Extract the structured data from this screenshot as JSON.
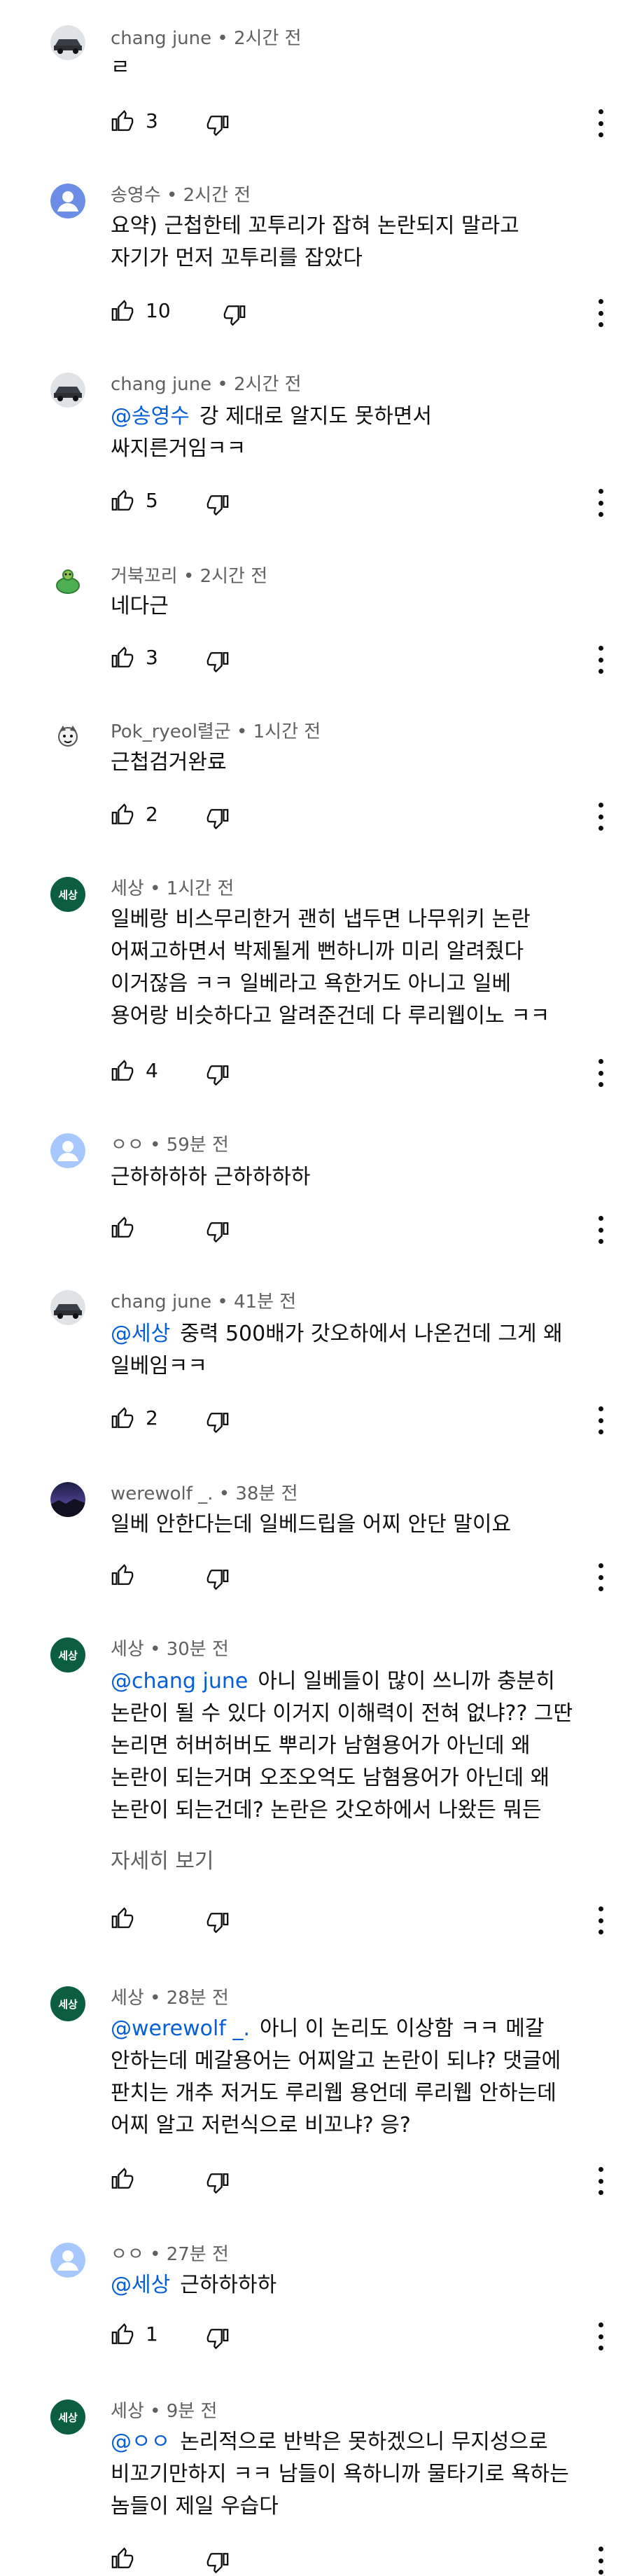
{
  "comments": [
    {
      "author": "chang june",
      "time": "2시간 전",
      "avatar": {
        "type": "car",
        "color": "#3a3f44"
      },
      "mention": "",
      "text": "ㄹ",
      "likes": "3"
    },
    {
      "author": "송영수",
      "time": "2시간 전",
      "avatar": {
        "type": "default",
        "color": "#6b8de6"
      },
      "mention": "",
      "text": "요약) 근첩한테 꼬투리가 잡혀 논란되지 말라고\n자기가 먼저 꼬투리를 잡았다",
      "likes": "10"
    },
    {
      "author": "chang june",
      "time": "2시간 전",
      "avatar": {
        "type": "car",
        "color": "#3a3f44"
      },
      "mention": "@송영수",
      "text": "강 제대로 알지도 못하면서\n싸지른거임ㅋㅋ",
      "likes": "5"
    },
    {
      "author": "거북꼬리",
      "time": "2시간 전",
      "avatar": {
        "type": "turtle",
        "color": "#4caf50"
      },
      "mention": "",
      "text": "네다근",
      "likes": "3"
    },
    {
      "author": "Pok_ryeol렬군",
      "time": "1시간 전",
      "avatar": {
        "type": "character",
        "color": "#888888"
      },
      "mention": "",
      "text": "근첩검거완료",
      "likes": "2"
    },
    {
      "author": "세상",
      "time": "1시간 전",
      "avatar": {
        "type": "text",
        "color": "#0b5e3f",
        "label": "세상"
      },
      "mention": "",
      "text": "일베랑 비스무리한거 괜히 냅두면 나무위키 논란\n어쩌고하면서 박제될게 뻔하니까 미리 알려줬다\n이거잖음 ㅋㅋ 일베라고 욕한거도 아니고 일베\n용어랑 비슷하다고 알려준건데 다 루리웹이노 ㅋㅋ",
      "likes": "4"
    },
    {
      "author": "ㅇㅇ",
      "time": "59분 전",
      "avatar": {
        "type": "default",
        "color": "#a6c8ff"
      },
      "mention": "",
      "text": "근하하하하 근하하하하",
      "likes": ""
    },
    {
      "author": "chang june",
      "time": "41분 전",
      "avatar": {
        "type": "car",
        "color": "#3a3f44"
      },
      "mention": "@세상",
      "text": "중력 500배가 갓오하에서 나온건데 그게 왜\n일베임ㅋㅋ",
      "likes": "2"
    },
    {
      "author": "werewolf _.",
      "time": "38분 전",
      "avatar": {
        "type": "landscape",
        "color": "#2b2d5c"
      },
      "mention": "",
      "text": "일베 안한다는데 일베드립을 어찌 안단 말이요",
      "likes": ""
    },
    {
      "author": "세상",
      "time": "30분 전",
      "avatar": {
        "type": "text",
        "color": "#0b5e3f",
        "label": "세상"
      },
      "mention": "@chang june",
      "text": "아니 일베들이 많이 쓰니까 충분히\n논란이 될 수 있다 이거지 이해력이 전혀 없냐?? 그딴\n논리면 허버허버도 뿌리가 남혐용어가 아닌데 왜\n논란이 되는거며 오조오억도 남혐용어가 아닌데 왜\n논란이 되는건데? 논란은 갓오하에서 나왔든 뭐든",
      "more": "자세히 보기",
      "likes": ""
    },
    {
      "author": "세상",
      "time": "28분 전",
      "avatar": {
        "type": "text",
        "color": "#0b5e3f",
        "label": "세상"
      },
      "mention": "@werewolf _.",
      "text": "아니 이 논리도 이상함 ㅋㅋ 메갈\n안하는데 메갈용어는 어찌알고 논란이 되냐? 댓글에\n판치는 개추 저거도 루리웹 용언데 루리웹 안하는데\n어찌 알고 저런식으로 비꼬냐? 응?",
      "likes": ""
    },
    {
      "author": "ㅇㅇ",
      "time": "27분 전",
      "avatar": {
        "type": "default",
        "color": "#a6c8ff"
      },
      "mention": "@세상",
      "text": "근하하하하",
      "likes": "1"
    },
    {
      "author": "세상",
      "time": "9분 전",
      "avatar": {
        "type": "text",
        "color": "#0b5e3f",
        "label": "세상"
      },
      "mention": "@ㅇㅇ",
      "text": "논리적으로 반박은 못하겠으니 무지성으로\n비꼬기만하지 ㅋㅋ 남들이 욕하니까 물타기로 욕하는\n놈들이 제일 우습다",
      "likes": ""
    }
  ]
}
